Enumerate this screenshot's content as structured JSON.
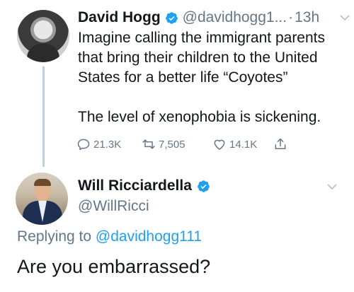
{
  "tweet": {
    "author_name": "David Hogg",
    "handle": "@davidhogg1...",
    "separator": "·",
    "time": "13h",
    "text": "Imagine calling the immigrant parents that bring their children to the United States for a better life “Coyotes”\n\nThe level of xenophobia is sickening.",
    "replies": "21.3K",
    "retweets": "7,505",
    "likes": "14.1K"
  },
  "reply": {
    "author_name": "Will Ricciardella",
    "handle": "@WillRicci",
    "replying_prefix": "Replying to",
    "replying_to": "@davidhogg111",
    "text": "Are you embarrassed?"
  },
  "colors": {
    "link": "#1da1f2",
    "muted": "#657786",
    "text": "#14171a",
    "verified": "#1da1f2"
  },
  "icons": [
    "verified-badge-icon",
    "chevron-down-icon",
    "reply-icon",
    "retweet-icon",
    "like-icon",
    "share-icon"
  ]
}
